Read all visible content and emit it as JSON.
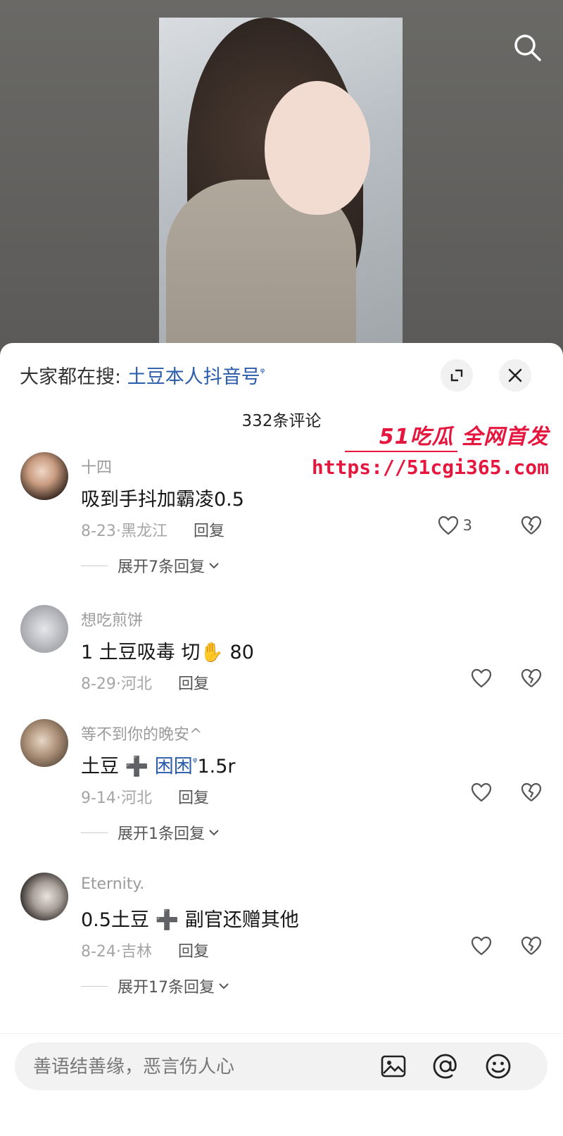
{
  "search_bar": {
    "prefix": "大家都在搜:",
    "link": "土豆本人抖音号"
  },
  "comment_count": "332条评论",
  "watermark": {
    "line1": "51吃瓜 全网首发",
    "line2": "https://51cgi365.com"
  },
  "comments": [
    {
      "username": "十四",
      "text": "吸到手抖加霸凌0.5",
      "date": "8-23",
      "location": "黑龙江",
      "reply": "回复",
      "likes": "3",
      "expand": "展开7条回复"
    },
    {
      "username": "想吃煎饼",
      "text": "1 土豆吸毒 切✋ 80",
      "date": "8-29",
      "location": "河北",
      "reply": "回复"
    },
    {
      "username": "等不到你的晚安^",
      "text_a": "土豆 ➕ ",
      "text_link": "困困",
      "text_b": "1.5r",
      "date": "9-14",
      "location": "河北",
      "reply": "回复",
      "expand": "展开1条回复"
    },
    {
      "username": "Eternity.",
      "text": "0.5土豆 ➕ 副官还赠其他",
      "date": "8-24",
      "location": "吉林",
      "reply": "回复",
      "expand": "展开17条回复"
    }
  ],
  "input": {
    "placeholder": "善语结善缘，恶言伤人心"
  }
}
